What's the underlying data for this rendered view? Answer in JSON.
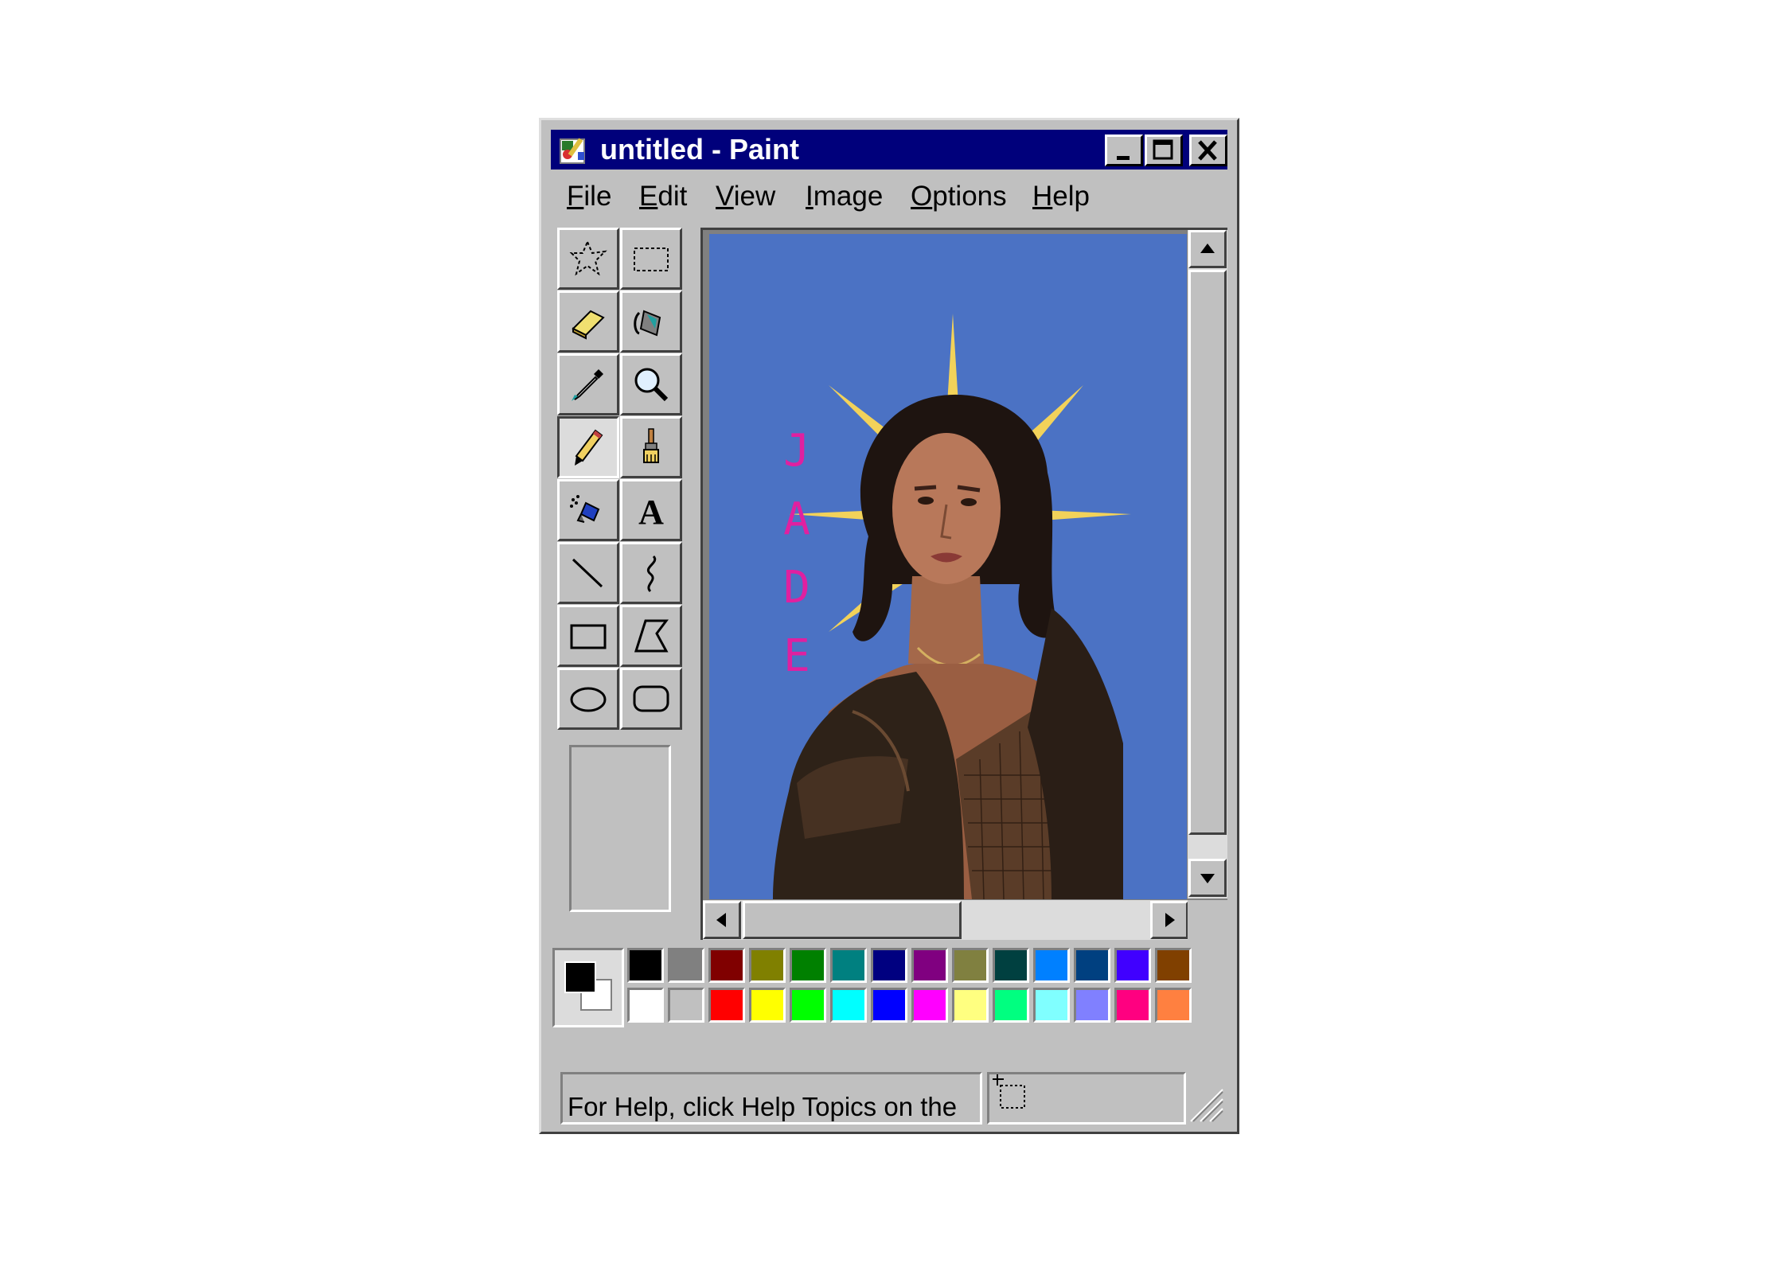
{
  "window": {
    "title": "untitled - Paint"
  },
  "titlebar": {
    "minimize_icon": "minimize-icon",
    "maximize_icon": "maximize-icon",
    "close_icon": "close-icon"
  },
  "menu": [
    "File",
    "Edit",
    "View",
    "Image",
    "Options",
    "Help"
  ],
  "tools": [
    "free-form-select",
    "select",
    "eraser",
    "fill-with-color",
    "pick-color",
    "magnifier",
    "pencil",
    "brush",
    "airbrush",
    "text",
    "line",
    "curve",
    "rectangle",
    "polygon",
    "ellipse",
    "rounded-rectangle"
  ],
  "active_tool": "pencil",
  "canvas": {
    "background_color": "#4b72c4",
    "text_letters": [
      "J",
      "A",
      "D",
      "E"
    ],
    "text_color": "#e020a0",
    "sunburst_color": "#f2d25a"
  },
  "palette": {
    "foreground": "#000000",
    "background": "#ffffff",
    "top_row": [
      "#000000",
      "#808080",
      "#800000",
      "#808000",
      "#008000",
      "#008080",
      "#000080",
      "#800080",
      "#808040",
      "#004040",
      "#0080ff",
      "#004080",
      "#4000ff",
      "#804000"
    ],
    "bottom_row": [
      "#ffffff",
      "#c0c0c0",
      "#ff0000",
      "#ffff00",
      "#00ff00",
      "#00ffff",
      "#0000ff",
      "#ff00ff",
      "#ffff80",
      "#00ff80",
      "#80ffff",
      "#8080ff",
      "#ff0080",
      "#ff8040"
    ]
  },
  "status": {
    "help_text": "For Help, click Help Topics on the"
  }
}
